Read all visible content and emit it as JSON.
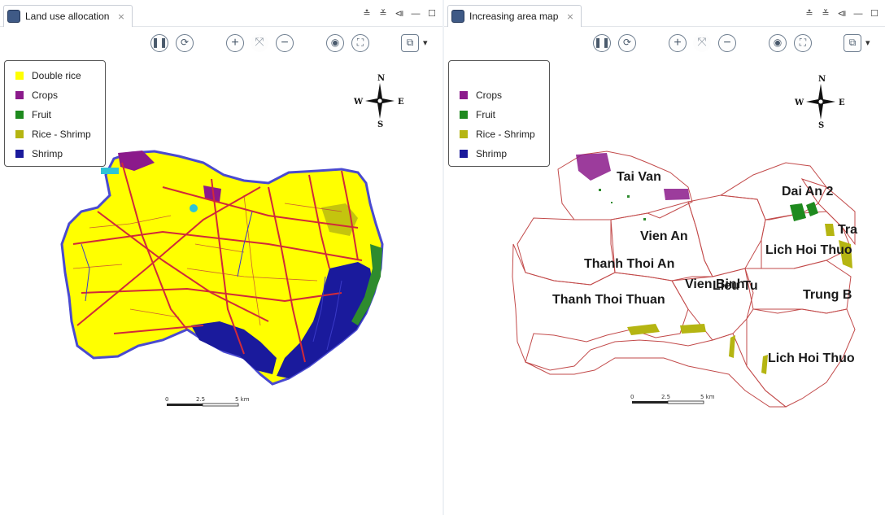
{
  "left_view": {
    "tab_title": "Land use allocation",
    "close_glyph": "⨯",
    "window_controls": [
      "≛",
      "≚",
      "⧏",
      "—",
      "☐"
    ],
    "legend": [
      {
        "label": "Double rice",
        "color": "#ffff00"
      },
      {
        "label": "Crops",
        "color": "#8b1a8b"
      },
      {
        "label": "Fruit",
        "color": "#1e8a1e"
      },
      {
        "label": "Rice - Shrimp",
        "color": "#b5b512"
      },
      {
        "label": "Shrimp",
        "color": "#1a1a9c"
      }
    ],
    "scale": {
      "labels": [
        "0",
        "2.5",
        "5 km"
      ]
    }
  },
  "right_view": {
    "tab_title": "Increasing area map",
    "close_glyph": "⨯",
    "window_controls": [
      "≛",
      "≚",
      "⧏",
      "—",
      "☐"
    ],
    "legend": [
      {
        "label": "Crops",
        "color": "#8b1a8b"
      },
      {
        "label": "Fruit",
        "color": "#1e8a1e"
      },
      {
        "label": "Rice - Shrimp",
        "color": "#b5b512"
      },
      {
        "label": "Shrimp",
        "color": "#1a1a9c"
      }
    ],
    "places": [
      "Tai Van",
      "Vien An",
      "Thanh Thoi An",
      "Thanh Thoi Thuan",
      "Vien Binh",
      "Lieu Tu",
      "Dai An 2",
      "Tra",
      "Lich Hoi Thuo",
      "Trung B",
      "Lich Hoi Thuo"
    ],
    "scale": {
      "labels": [
        "0",
        "2.5",
        "5 km"
      ]
    }
  },
  "toolbar": {
    "pause_icon": "pause-icon",
    "sync_icon": "sync-icon",
    "zoom_in_icon": "zoom-in-icon",
    "fit_icon": "fit-icon",
    "zoom_out_icon": "zoom-out-icon",
    "snapshot_icon": "camera-icon",
    "fullscreen_icon": "fullscreen-icon",
    "layers_icon": "layers-icon",
    "dropdown_glyph": "▾"
  },
  "compass": {
    "n": "N",
    "s": "S",
    "e": "E",
    "w": "W"
  }
}
